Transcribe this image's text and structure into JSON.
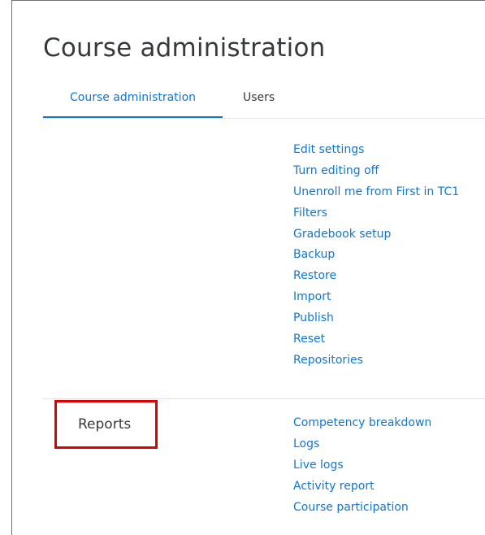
{
  "page": {
    "title": "Course administration"
  },
  "tabs": [
    {
      "label": "Course administration",
      "active": true
    },
    {
      "label": "Users",
      "active": false
    }
  ],
  "settings_links": [
    "Edit settings",
    "Turn editing off",
    "Unenroll me from First in TC1",
    "Filters",
    "Gradebook setup",
    "Backup",
    "Restore",
    "Import",
    "Publish",
    "Reset",
    "Repositories"
  ],
  "reports": {
    "heading": "Reports",
    "highlight_color": "#e00000",
    "links": [
      "Competency breakdown",
      "Logs",
      "Live logs",
      "Activity report",
      "Course participation"
    ]
  },
  "colors": {
    "link": "#1177d1",
    "text": "#373a3c"
  }
}
